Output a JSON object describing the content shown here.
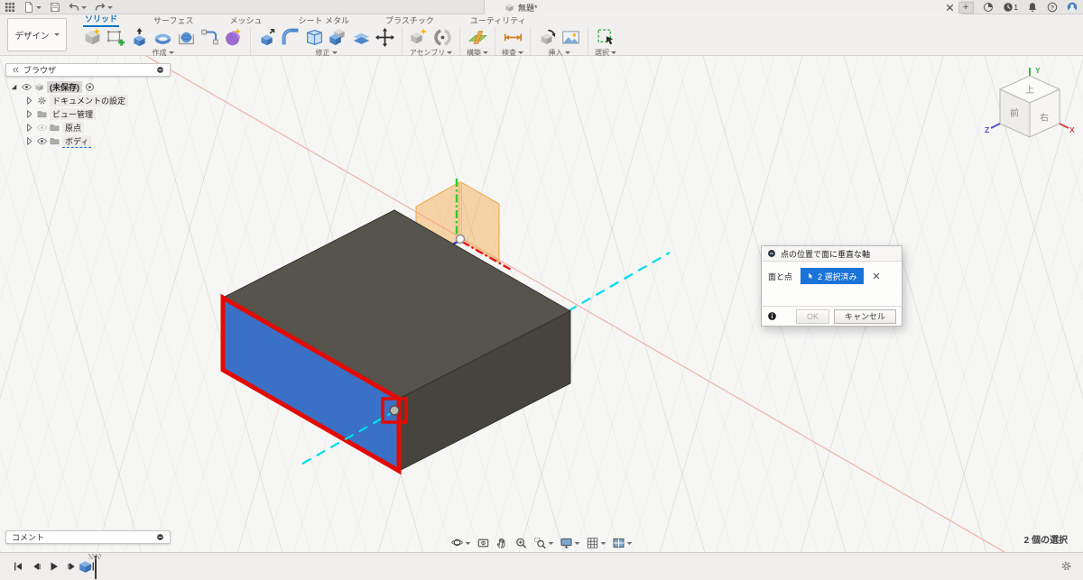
{
  "titlebar": {
    "doc_tab": {
      "title": "無題*"
    },
    "qat": [
      {
        "name": "app-grid"
      },
      {
        "name": "file-new",
        "caret": true
      },
      {
        "name": "save"
      },
      {
        "name": "undo",
        "caret": true
      },
      {
        "name": "redo",
        "caret": true
      }
    ],
    "right_icons": [
      {
        "name": "tab-add",
        "glyph": "+"
      },
      {
        "name": "extensions"
      },
      {
        "name": "job-status",
        "badge": "1"
      },
      {
        "name": "notifications"
      },
      {
        "name": "help"
      },
      {
        "name": "profile"
      }
    ]
  },
  "ribbon": {
    "workspace": {
      "label": "デザイン"
    },
    "tabs": [
      {
        "label": "ソリッド",
        "active": true
      },
      {
        "label": "サーフェス",
        "active": false
      },
      {
        "label": "メッシュ",
        "active": false
      },
      {
        "label": "シート メタル",
        "active": false
      },
      {
        "label": "プラスチック",
        "active": false
      },
      {
        "label": "ユーティリティ",
        "active": false
      }
    ],
    "groups": [
      {
        "label": "作成",
        "icons": [
          "create-solid",
          "create-sketch",
          "extrude",
          "revolve",
          "sphere",
          "pipe",
          "form"
        ]
      },
      {
        "label": "修正",
        "icons": [
          "press-pull",
          "fillet",
          "shell",
          "combine",
          "split-body",
          "move"
        ]
      },
      {
        "label": "アセンブリ",
        "icons": [
          "new-component",
          "joint"
        ]
      },
      {
        "label": "構築",
        "icons": [
          "construct-plane"
        ]
      },
      {
        "label": "検査",
        "icons": [
          "measure"
        ]
      },
      {
        "label": "挿入",
        "icons": [
          "insert-mesh",
          "canvas"
        ]
      },
      {
        "label": "選択",
        "icons": [
          "select"
        ]
      }
    ]
  },
  "browser": {
    "header": "ブラウザ",
    "items": [
      {
        "label": "(未保存)",
        "icon": "doc-cube",
        "eye": "on",
        "expander": "expanded",
        "suffix": "activate-dot",
        "root": true,
        "indent": 0,
        "selected": false
      },
      {
        "label": "ドキュメントの設定",
        "icon": "gear",
        "eye": "",
        "expander": "collapsed",
        "indent": 1,
        "selected": false
      },
      {
        "label": "ビュー管理",
        "icon": "folder",
        "eye": "",
        "expander": "collapsed",
        "indent": 1,
        "selected": false
      },
      {
        "label": "原点",
        "icon": "folder",
        "eye": "off",
        "expander": "collapsed",
        "indent": 1,
        "selected": false
      },
      {
        "label": "ボディ",
        "icon": "folder",
        "eye": "on",
        "expander": "collapsed",
        "indent": 1,
        "selected": true
      }
    ]
  },
  "comments": {
    "header": "コメント"
  },
  "dialog": {
    "title": "点の位置で面に垂直な軸",
    "field_label": "面と点",
    "chip_label": "2 選択済み",
    "ok": "OK",
    "cancel": "キャンセル"
  },
  "viewcube": {
    "faces": {
      "top": "上",
      "front": "前",
      "right": "右"
    },
    "axes": {
      "x": "X",
      "y": "Y",
      "z": "Z"
    }
  },
  "status": {
    "selection_text": "2 個の選択"
  },
  "nav_toolbar": [
    {
      "name": "orbit",
      "caret": true
    },
    {
      "name": "look-at",
      "caret": false
    },
    {
      "name": "pan",
      "caret": false
    },
    {
      "name": "zoom",
      "caret": false
    },
    {
      "name": "zoom-window",
      "caret": true
    },
    {
      "name": "display-settings",
      "caret": true
    },
    {
      "name": "grid-settings",
      "caret": true
    },
    {
      "name": "viewports",
      "caret": true
    }
  ],
  "timeline": {
    "controls": [
      "skip-start",
      "step-back",
      "play",
      "step-forward",
      "skip-end"
    ]
  },
  "scene": {
    "colors": {
      "box_top": "#56544c",
      "box_right": "#46443d",
      "box_front": "#3a70c5",
      "sel_red": "#e30b00",
      "axis_cyan": "#00dcee",
      "plane_orange": "#f3a33c",
      "axis_x_bold": "#e01414",
      "axis_x_inf": "#f0b6b0",
      "axis_y": "#2ecc2e",
      "axis_z": "#2a2ac8",
      "edge": "#33312c"
    }
  }
}
